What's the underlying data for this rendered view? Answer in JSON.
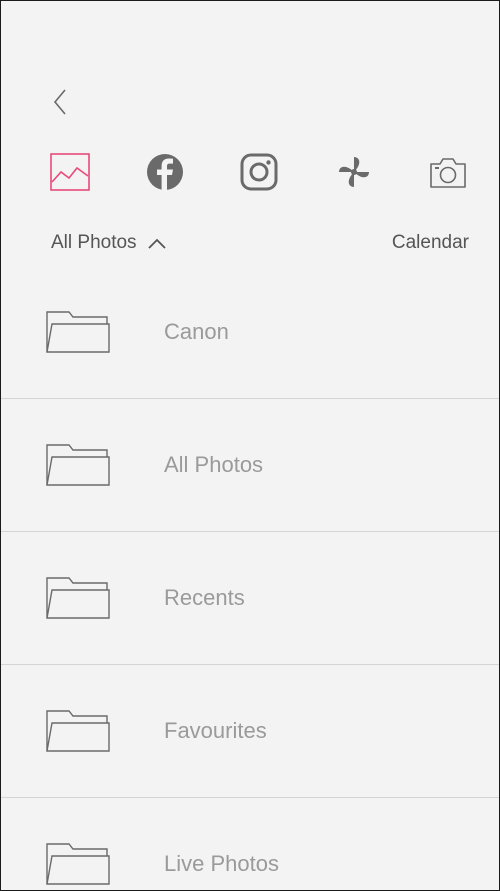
{
  "nav": {
    "back_icon": "chevron-left-icon"
  },
  "sources": [
    {
      "icon": "photos-gallery-icon",
      "selected": true
    },
    {
      "icon": "facebook-icon",
      "selected": false
    },
    {
      "icon": "instagram-icon",
      "selected": false
    },
    {
      "icon": "pinwheel-icon",
      "selected": false
    },
    {
      "icon": "camera-icon",
      "selected": false
    }
  ],
  "filter": {
    "album_selector_label": "All Photos",
    "album_selector_icon": "chevron-up-icon",
    "calendar_label": "Calendar"
  },
  "albums": [
    {
      "label": "Canon",
      "icon": "folder-icon"
    },
    {
      "label": "All Photos",
      "icon": "folder-icon"
    },
    {
      "label": "Recents",
      "icon": "folder-icon"
    },
    {
      "label": "Favourites",
      "icon": "folder-icon"
    },
    {
      "label": "Live Photos",
      "icon": "folder-icon"
    }
  ],
  "colors": {
    "accent": "#e94b7a",
    "icon_gray": "#6a6a6a",
    "label_gray": "#9a9a9a",
    "background": "#f3f3f3",
    "divider": "#d4d4d4"
  }
}
